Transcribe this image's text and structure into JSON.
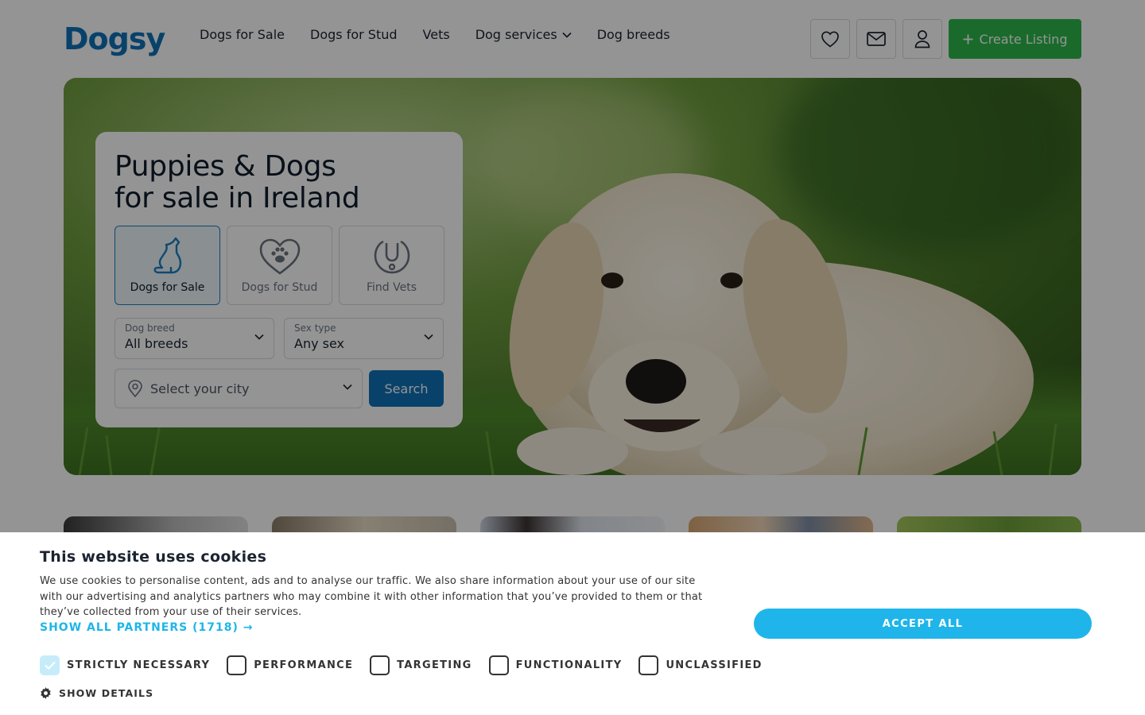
{
  "brand": {
    "logo_text": "Dogsy",
    "primary_color": "#0e73b8",
    "accent_color": "#2eb84b"
  },
  "nav": {
    "items": [
      {
        "label": "Dogs for Sale"
      },
      {
        "label": "Dogs for Stud"
      },
      {
        "label": "Vets"
      },
      {
        "label": "Dog services",
        "has_dropdown": true
      },
      {
        "label": "Dog breeds"
      }
    ]
  },
  "header_actions": {
    "favorites_icon": "heart-icon",
    "messages_icon": "mail-icon",
    "account_icon": "user-icon",
    "create_listing_label": "Create Listing"
  },
  "hero": {
    "title_line1": "Puppies & Dogs",
    "title_line2": "for sale in Ireland",
    "categories": [
      {
        "label": "Dogs for Sale",
        "icon": "sitting-dog-icon",
        "selected": true
      },
      {
        "label": "Dogs for Stud",
        "icon": "heart-paw-icon",
        "selected": false
      },
      {
        "label": "Find Vets",
        "icon": "stethoscope-icon",
        "selected": false
      }
    ],
    "breed_select": {
      "label": "Dog breed",
      "value": "All breeds"
    },
    "sex_select": {
      "label": "Sex type",
      "value": "Any sex"
    },
    "city_select": {
      "placeholder": "Select your city"
    },
    "search_label": "Search"
  },
  "cookie_banner": {
    "title": "This website uses cookies",
    "body": "We use cookies to personalise content, ads and to analyse our traffic. We also share information about your use of our site with our advertising and analytics partners who may combine it with other information that you’ve provided to them or that they’ve collected from your use of their services.",
    "partners_link": "SHOW ALL PARTNERS (1718) →",
    "categories": [
      {
        "label": "STRICTLY NECESSARY",
        "checked": true
      },
      {
        "label": "PERFORMANCE",
        "checked": false
      },
      {
        "label": "TARGETING",
        "checked": false
      },
      {
        "label": "FUNCTIONALITY",
        "checked": false
      },
      {
        "label": "UNCLASSIFIED",
        "checked": false
      }
    ],
    "show_details": "SHOW DETAILS",
    "accept_label": "ACCEPT ALL",
    "accept_color": "#1fb5ea"
  }
}
